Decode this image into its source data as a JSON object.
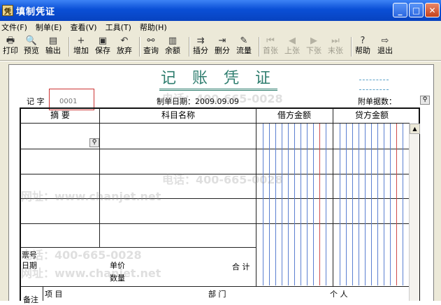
{
  "window": {
    "title": "填制凭证",
    "app_icon": "凭"
  },
  "menu": [
    "文件(F)",
    "制单(E)",
    "查看(V)",
    "工具(T)",
    "帮助(H)"
  ],
  "toolbar": {
    "print": "打印",
    "preview": "预览",
    "export": "输出",
    "add": "增加",
    "save": "保存",
    "discard": "放弃",
    "query": "查询",
    "balance": "余额",
    "insert_row": "插分",
    "delete_row": "删分",
    "flow": "流量",
    "first": "首张",
    "prev": "上张",
    "next": "下张",
    "last": "末张",
    "help": "帮助",
    "exit": "退出"
  },
  "voucher": {
    "title": "记 账 凭 证",
    "type_label": "记 字",
    "number": "0001",
    "date_label": "制单日期：2009.09.09",
    "attachments_label": "附单据数："
  },
  "columns": {
    "summary": "摘 要",
    "account": "科目名称",
    "debit": "借方金额",
    "credit": "贷方金额"
  },
  "footer": {
    "bill_no": "票号",
    "date": "日期",
    "unit_price": "单价",
    "quantity": "数量",
    "total": "合 计",
    "remarks": "备注",
    "project": "项 目",
    "department": "部 门",
    "person": "个 人"
  },
  "watermark": {
    "phone": "电话：400-665-0028",
    "site": "网址：www.chanjet.net"
  }
}
